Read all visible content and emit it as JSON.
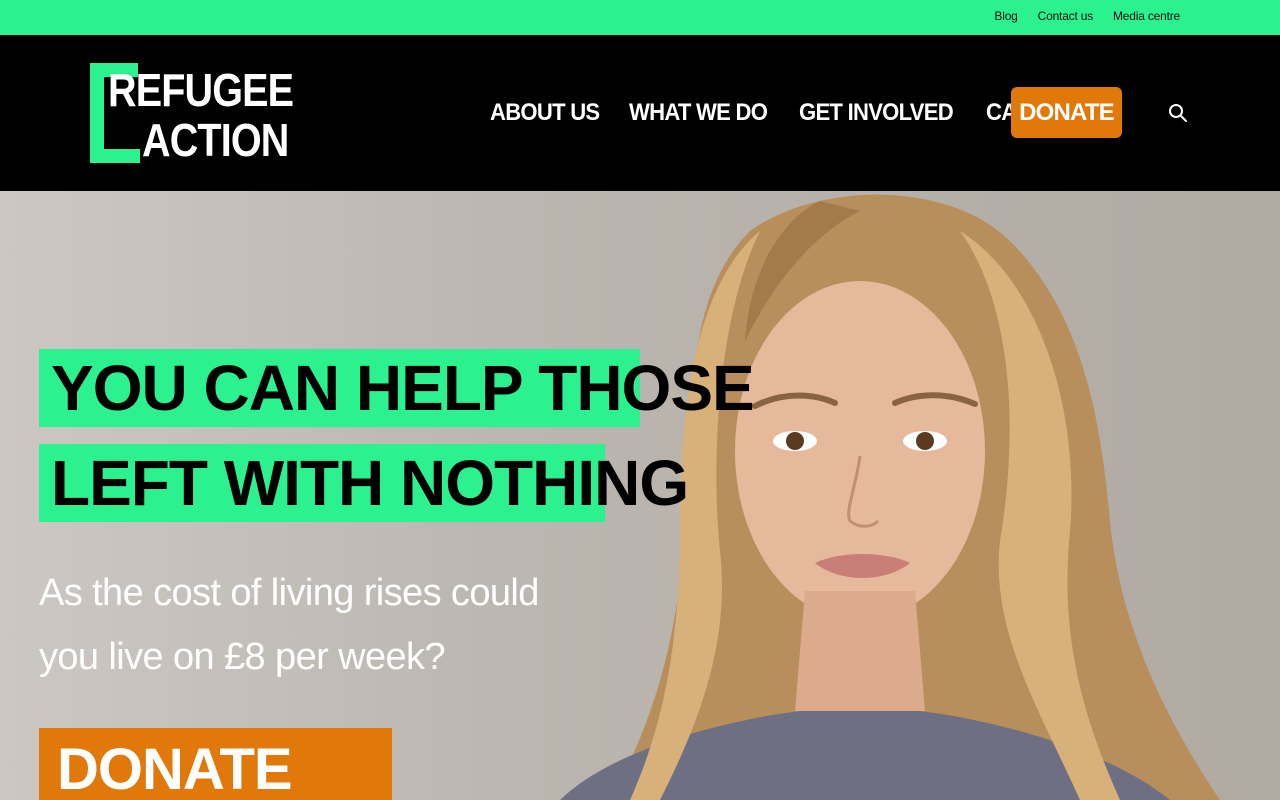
{
  "utility_bar": {
    "links": [
      "Blog",
      "Contact us",
      "Media centre"
    ]
  },
  "logo": {
    "line1": "REFUGEE",
    "line2": "ACTION"
  },
  "nav": {
    "items": [
      "ABOUT US",
      "WHAT WE DO",
      "GET INVOLVED",
      "CAMPAIGNS"
    ],
    "donate_label": "DONATE",
    "search_icon": "search-icon"
  },
  "hero": {
    "headline_line1": "YOU CAN HELP THOSE",
    "headline_line2": "LEFT WITH NOTHING",
    "subtext": "As the cost of living rises could you live on £8 per week?",
    "cta_label": "DONATE NOW"
  },
  "colors": {
    "accent_green": "#2bf28f",
    "donate_orange": "#e0790a",
    "header_bg": "#000000"
  }
}
